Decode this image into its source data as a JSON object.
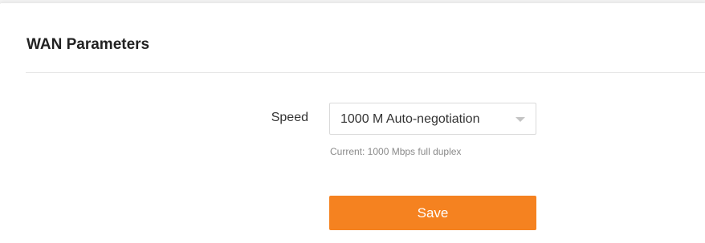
{
  "panel": {
    "title": "WAN Parameters"
  },
  "speed": {
    "label": "Speed",
    "selected": "1000 M Auto-negotiation",
    "current_status": "Current: 1000 Mbps full duplex"
  },
  "actions": {
    "save_label": "Save"
  },
  "colors": {
    "accent": "#f58220",
    "page_background": "#f2f2f2",
    "card_background": "#ffffff"
  },
  "icons": {
    "dropdown": "chevron-down-icon"
  }
}
